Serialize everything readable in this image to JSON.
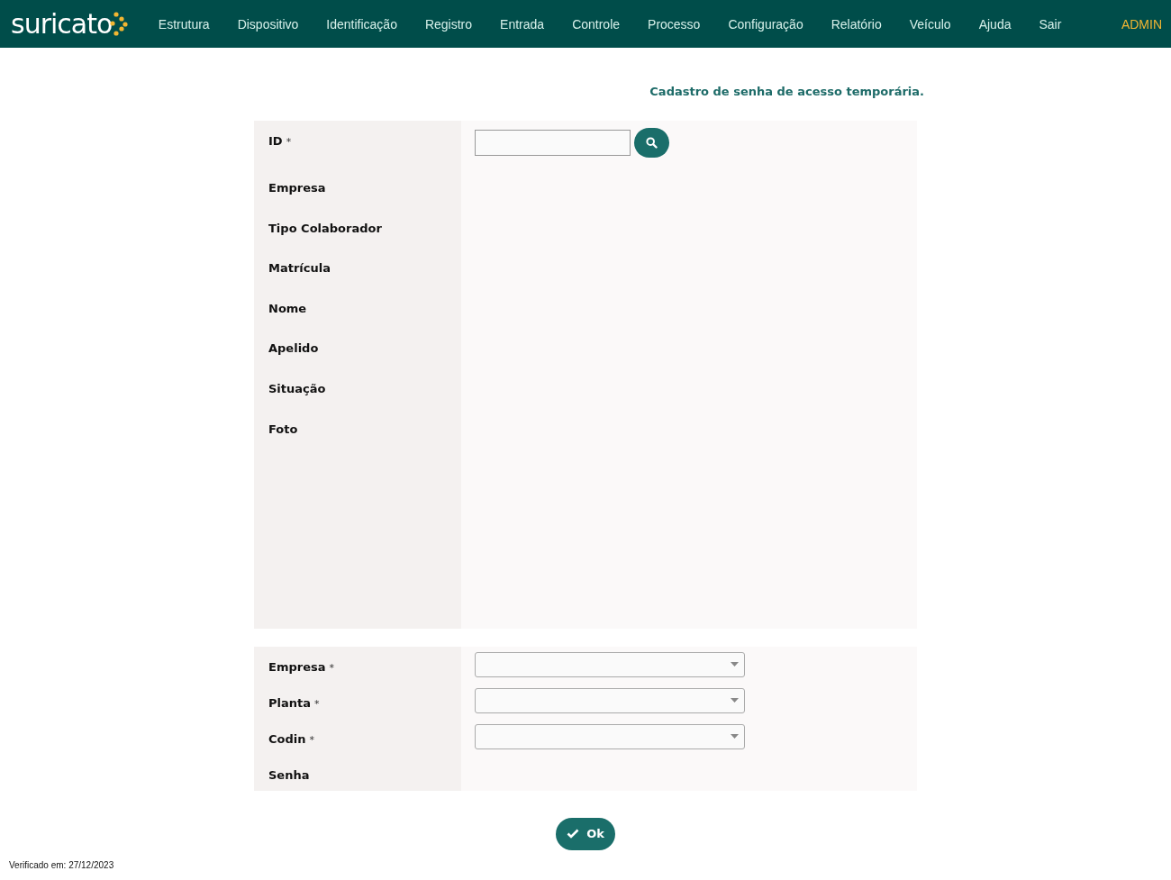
{
  "header": {
    "logo": "suricato",
    "menu": [
      {
        "label": "Estrutura"
      },
      {
        "label": "Dispositivo"
      },
      {
        "label": "Identificação"
      },
      {
        "label": "Registro"
      },
      {
        "label": "Entrada"
      },
      {
        "label": "Controle"
      },
      {
        "label": "Processo"
      },
      {
        "label": "Configuração"
      },
      {
        "label": "Relatório"
      },
      {
        "label": "Veículo"
      },
      {
        "label": "Ajuda"
      },
      {
        "label": "Sair"
      }
    ],
    "user": "ADMIN"
  },
  "page_title": "Cadastro de senha de acesso temporária.",
  "details": [
    {
      "label": "ID",
      "mark": "*",
      "kind": "search"
    },
    {
      "label": "Empresa",
      "kind": "text"
    },
    {
      "label": "Tipo Colaborador",
      "kind": "text"
    },
    {
      "label": "Matrícula",
      "kind": "text"
    },
    {
      "label": "Nome",
      "kind": "text"
    },
    {
      "label": "Apelido",
      "kind": "text"
    },
    {
      "label": "Situação",
      "kind": "text"
    },
    {
      "label": "Foto",
      "kind": "photo"
    }
  ],
  "access": [
    {
      "label": "Empresa",
      "mark": "*",
      "kind": "select"
    },
    {
      "label": "Planta",
      "mark": "*",
      "kind": "select"
    },
    {
      "label": "Codin",
      "mark": "*",
      "kind": "select"
    },
    {
      "label": "Senha",
      "kind": "text"
    }
  ],
  "ok_button": "Ok",
  "footer": "Verificado em: 27/12/2023"
}
